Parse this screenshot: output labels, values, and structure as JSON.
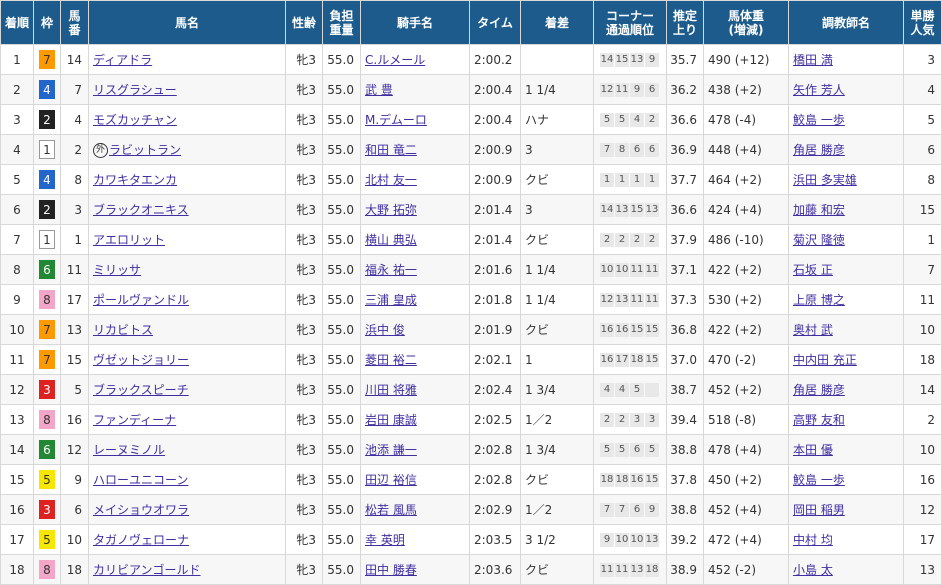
{
  "headers": [
    {
      "l1": "着順",
      "l2": ""
    },
    {
      "l1": "枠",
      "l2": ""
    },
    {
      "l1": "馬",
      "l2": "番"
    },
    {
      "l1": "馬名",
      "l2": ""
    },
    {
      "l1": "性齢",
      "l2": ""
    },
    {
      "l1": "負担",
      "l2": "重量"
    },
    {
      "l1": "騎手名",
      "l2": ""
    },
    {
      "l1": "タイム",
      "l2": ""
    },
    {
      "l1": "着差",
      "l2": ""
    },
    {
      "l1": "コーナー",
      "l2": "通過順位"
    },
    {
      "l1": "推定",
      "l2": "上り"
    },
    {
      "l1": "馬体重",
      "l2": "(増減)"
    },
    {
      "l1": "調教師名",
      "l2": ""
    },
    {
      "l1": "単勝",
      "l2": "人気"
    }
  ],
  "waku_colors": {
    "1": {
      "bg": "#ffffff",
      "fg": "#333333",
      "border": "#999999"
    },
    "2": {
      "bg": "#222222",
      "fg": "#ffffff",
      "border": "#222222"
    },
    "3": {
      "bg": "#dd2222",
      "fg": "#ffffff",
      "border": "#dd2222"
    },
    "4": {
      "bg": "#2266cc",
      "fg": "#ffffff",
      "border": "#2266cc"
    },
    "5": {
      "bg": "#f6e600",
      "fg": "#333333",
      "border": "#f6e600"
    },
    "6": {
      "bg": "#228833",
      "fg": "#ffffff",
      "border": "#228833"
    },
    "7": {
      "bg": "#ff9900",
      "fg": "#333333",
      "border": "#ff9900"
    },
    "8": {
      "bg": "#f4a6c8",
      "fg": "#333333",
      "border": "#f4a6c8"
    }
  },
  "rows": [
    {
      "rank": "1",
      "waku": "7",
      "num": "14",
      "horse": "ディアドラ",
      "gaikoku": "",
      "sex_age": "牝3",
      "weight": "55.0",
      "jockey": "C.ルメール",
      "time": "2:00.2",
      "margin": "",
      "corners": [
        "14",
        "15",
        "13",
        "9"
      ],
      "agari": "35.7",
      "body_weight": "490 (+12)",
      "trainer": "橋田 満",
      "pop": "3"
    },
    {
      "rank": "2",
      "waku": "4",
      "num": "7",
      "horse": "リスグラシュー",
      "gaikoku": "",
      "sex_age": "牝3",
      "weight": "55.0",
      "jockey": "武 豊",
      "time": "2:00.4",
      "margin": "1 1/4",
      "corners": [
        "12",
        "11",
        "9",
        "6"
      ],
      "agari": "36.2",
      "body_weight": "438 (+2)",
      "trainer": "矢作 芳人",
      "pop": "4"
    },
    {
      "rank": "3",
      "waku": "2",
      "num": "4",
      "horse": "モズカッチャン",
      "gaikoku": "",
      "sex_age": "牝3",
      "weight": "55.0",
      "jockey": "M.デムーロ",
      "time": "2:00.4",
      "margin": "ハナ",
      "corners": [
        "5",
        "5",
        "4",
        "2"
      ],
      "agari": "36.6",
      "body_weight": "478 (-4)",
      "trainer": "鮫島 一歩",
      "pop": "5"
    },
    {
      "rank": "4",
      "waku": "1",
      "num": "2",
      "horse": "ラビットラン",
      "gaikoku": "外",
      "sex_age": "牝3",
      "weight": "55.0",
      "jockey": "和田 竜二",
      "time": "2:00.9",
      "margin": "3",
      "corners": [
        "7",
        "8",
        "6",
        "6"
      ],
      "agari": "36.9",
      "body_weight": "448 (+4)",
      "trainer": "角居 勝彦",
      "pop": "6"
    },
    {
      "rank": "5",
      "waku": "4",
      "num": "8",
      "horse": "カワキタエンカ",
      "gaikoku": "",
      "sex_age": "牝3",
      "weight": "55.0",
      "jockey": "北村 友一",
      "time": "2:00.9",
      "margin": "クビ",
      "corners": [
        "1",
        "1",
        "1",
        "1"
      ],
      "agari": "37.7",
      "body_weight": "464 (+2)",
      "trainer": "浜田 多実雄",
      "pop": "8"
    },
    {
      "rank": "6",
      "waku": "2",
      "num": "3",
      "horse": "ブラックオニキス",
      "gaikoku": "",
      "sex_age": "牝3",
      "weight": "55.0",
      "jockey": "大野 拓弥",
      "time": "2:01.4",
      "margin": "3",
      "corners": [
        "14",
        "13",
        "15",
        "13"
      ],
      "agari": "36.6",
      "body_weight": "424 (+4)",
      "trainer": "加藤 和宏",
      "pop": "15"
    },
    {
      "rank": "7",
      "waku": "1",
      "num": "1",
      "horse": "アエロリット",
      "gaikoku": "",
      "sex_age": "牝3",
      "weight": "55.0",
      "jockey": "横山 典弘",
      "time": "2:01.4",
      "margin": "クビ",
      "corners": [
        "2",
        "2",
        "2",
        "2"
      ],
      "agari": "37.9",
      "body_weight": "486 (-10)",
      "trainer": "菊沢 隆徳",
      "pop": "1"
    },
    {
      "rank": "8",
      "waku": "6",
      "num": "11",
      "horse": "ミリッサ",
      "gaikoku": "",
      "sex_age": "牝3",
      "weight": "55.0",
      "jockey": "福永 祐一",
      "time": "2:01.6",
      "margin": "1 1/4",
      "corners": [
        "10",
        "10",
        "11",
        "11"
      ],
      "agari": "37.1",
      "body_weight": "422 (+2)",
      "trainer": "石坂 正",
      "pop": "7"
    },
    {
      "rank": "9",
      "waku": "8",
      "num": "17",
      "horse": "ポールヴァンドル",
      "gaikoku": "",
      "sex_age": "牝3",
      "weight": "55.0",
      "jockey": "三浦 皇成",
      "time": "2:01.8",
      "margin": "1 1/4",
      "corners": [
        "12",
        "13",
        "11",
        "11"
      ],
      "agari": "37.3",
      "body_weight": "530 (+2)",
      "trainer": "上原 博之",
      "pop": "11"
    },
    {
      "rank": "10",
      "waku": "7",
      "num": "13",
      "horse": "リカビトス",
      "gaikoku": "",
      "sex_age": "牝3",
      "weight": "55.0",
      "jockey": "浜中 俊",
      "time": "2:01.9",
      "margin": "クビ",
      "corners": [
        "16",
        "16",
        "15",
        "15"
      ],
      "agari": "36.8",
      "body_weight": "422 (+2)",
      "trainer": "奥村 武",
      "pop": "10"
    },
    {
      "rank": "11",
      "waku": "7",
      "num": "15",
      "horse": "ヴゼットジョリー",
      "gaikoku": "",
      "sex_age": "牝3",
      "weight": "55.0",
      "jockey": "菱田 裕二",
      "time": "2:02.1",
      "margin": "1",
      "corners": [
        "16",
        "17",
        "18",
        "15"
      ],
      "agari": "37.0",
      "body_weight": "470 (-2)",
      "trainer": "中内田 充正",
      "pop": "18"
    },
    {
      "rank": "12",
      "waku": "3",
      "num": "5",
      "horse": "ブラックスピーチ",
      "gaikoku": "",
      "sex_age": "牝3",
      "weight": "55.0",
      "jockey": "川田 将雅",
      "time": "2:02.4",
      "margin": "1 3/4",
      "corners": [
        "4",
        "4",
        "5",
        ""
      ],
      "agari": "38.7",
      "body_weight": "452 (+2)",
      "trainer": "角居 勝彦",
      "pop": "14"
    },
    {
      "rank": "13",
      "waku": "8",
      "num": "16",
      "horse": "ファンディーナ",
      "gaikoku": "",
      "sex_age": "牝3",
      "weight": "55.0",
      "jockey": "岩田 康誠",
      "time": "2:02.5",
      "margin": "1／2",
      "corners": [
        "2",
        "2",
        "3",
        "3"
      ],
      "agari": "39.4",
      "body_weight": "518 (-8)",
      "trainer": "高野 友和",
      "pop": "2"
    },
    {
      "rank": "14",
      "waku": "6",
      "num": "12",
      "horse": "レーヌミノル",
      "gaikoku": "",
      "sex_age": "牝3",
      "weight": "55.0",
      "jockey": "池添 謙一",
      "time": "2:02.8",
      "margin": "1 3/4",
      "corners": [
        "5",
        "5",
        "6",
        "5"
      ],
      "agari": "38.8",
      "body_weight": "478 (+4)",
      "trainer": "本田 優",
      "pop": "10"
    },
    {
      "rank": "15",
      "waku": "5",
      "num": "9",
      "horse": "ハローユニコーン",
      "gaikoku": "",
      "sex_age": "牝3",
      "weight": "55.0",
      "jockey": "田辺 裕信",
      "time": "2:02.8",
      "margin": "クビ",
      "corners": [
        "18",
        "18",
        "16",
        "15"
      ],
      "agari": "37.8",
      "body_weight": "450 (+2)",
      "trainer": "鮫島 一歩",
      "pop": "16"
    },
    {
      "rank": "16",
      "waku": "3",
      "num": "6",
      "horse": "メイショウオワラ",
      "gaikoku": "",
      "sex_age": "牝3",
      "weight": "55.0",
      "jockey": "松若 風馬",
      "time": "2:02.9",
      "margin": "1／2",
      "corners": [
        "7",
        "7",
        "6",
        "9"
      ],
      "agari": "38.8",
      "body_weight": "452 (+4)",
      "trainer": "岡田 稲男",
      "pop": "12"
    },
    {
      "rank": "17",
      "waku": "5",
      "num": "10",
      "horse": "タガノヴェローナ",
      "gaikoku": "",
      "sex_age": "牝3",
      "weight": "55.0",
      "jockey": "幸 英明",
      "time": "2:03.5",
      "margin": "3 1/2",
      "corners": [
        "9",
        "10",
        "10",
        "13"
      ],
      "agari": "39.2",
      "body_weight": "472 (+4)",
      "trainer": "中村 均",
      "pop": "17"
    },
    {
      "rank": "18",
      "waku": "8",
      "num": "18",
      "horse": "カリビアンゴールド",
      "gaikoku": "",
      "sex_age": "牝3",
      "weight": "55.0",
      "jockey": "田中 勝春",
      "time": "2:03.6",
      "margin": "クビ",
      "corners": [
        "11",
        "11",
        "13",
        "18"
      ],
      "agari": "38.9",
      "body_weight": "452 (-2)",
      "trainer": "小島 太",
      "pop": "13"
    }
  ]
}
